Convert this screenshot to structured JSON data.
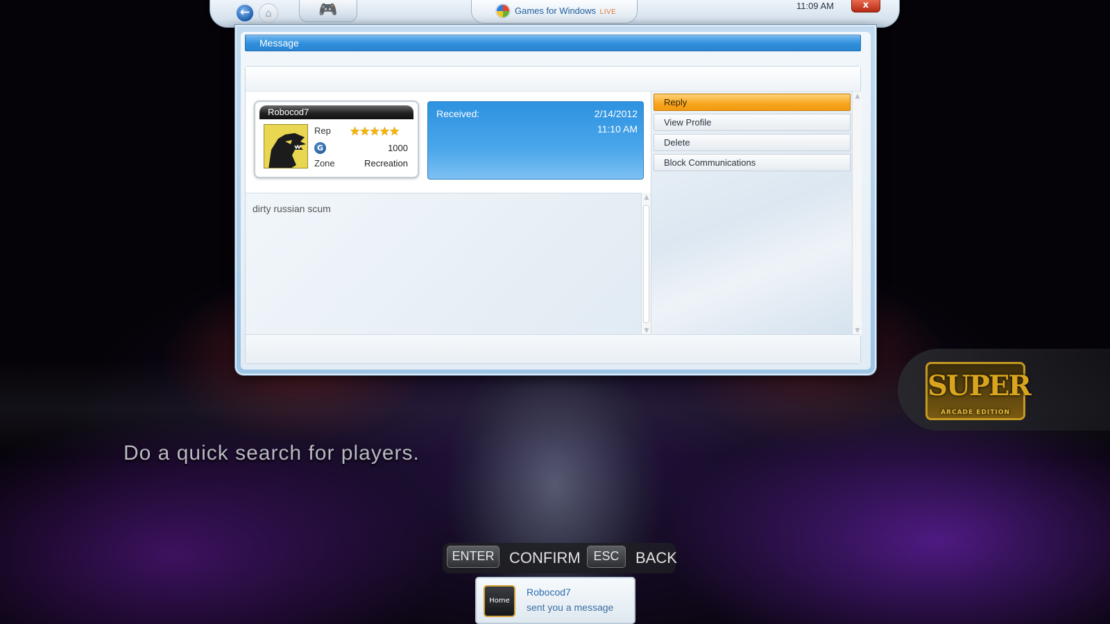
{
  "topbar": {
    "brand": "Games for Windows",
    "brand_live": "LIVE",
    "clock": "11:09 AM",
    "close_label": "x"
  },
  "window": {
    "title": "Message"
  },
  "gamer_card": {
    "gamertag": "Robocod7",
    "rep_label": "Rep",
    "rep_stars": 5,
    "gamerscore": "1000",
    "zone_label": "Zone",
    "zone": "Recreation"
  },
  "received": {
    "label": "Received:",
    "date": "2/14/2012",
    "time": "11:10 AM"
  },
  "message": {
    "body": "dirty russian scum"
  },
  "menu": {
    "items": [
      {
        "label": "Reply",
        "active": true
      },
      {
        "label": "View Profile",
        "active": false
      },
      {
        "label": "Delete",
        "active": false
      },
      {
        "label": "Block Communications",
        "active": false
      }
    ]
  },
  "background": {
    "hint": "Do a quick search for players.",
    "logo_text": "SUPER",
    "logo_subtext": "ARCADE EDITION"
  },
  "prompts": {
    "confirm_key": "ENTER",
    "confirm_label": "CONFIRM",
    "back_key": "ESC",
    "back_label": "BACK"
  },
  "notification": {
    "icon_label": "Home",
    "sender": "Robocod7",
    "text": "sent you a message"
  },
  "colors": {
    "accent_blue": "#2f8fdc",
    "active_item": "#f7a51d",
    "close_red": "#c8361d"
  }
}
